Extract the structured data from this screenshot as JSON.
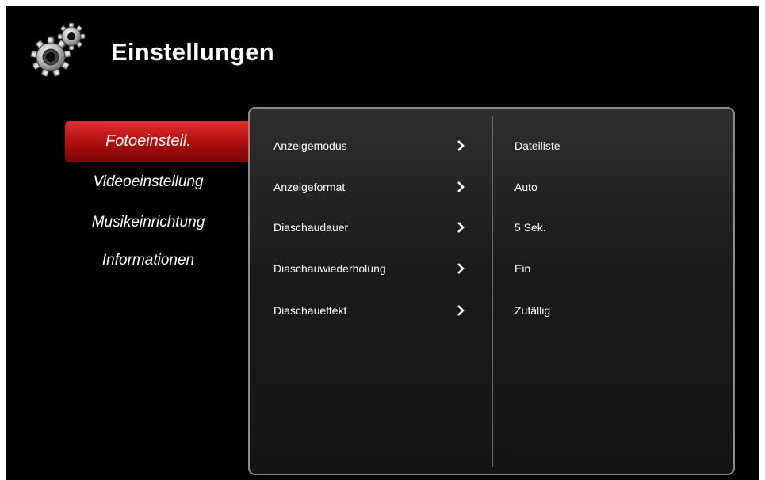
{
  "header": {
    "title": "Einstellungen",
    "icon": "gear-icon"
  },
  "sidebar": {
    "items": [
      {
        "label": "Fotoeinstell.",
        "active": true
      },
      {
        "label": "Videoeinstellung",
        "active": false
      },
      {
        "label": "Musikeinrichtung",
        "active": false
      },
      {
        "label": "Informationen",
        "active": false
      }
    ]
  },
  "settings": {
    "rows": [
      {
        "label": "Anzeigemodus",
        "value": "Dateiliste"
      },
      {
        "label": "Anzeigeformat",
        "value": "Auto"
      },
      {
        "label": "Diaschaudauer",
        "value": "5 Sek."
      },
      {
        "label": "Diaschauwiederholung",
        "value": "Ein"
      },
      {
        "label": "Diaschaueffekt",
        "value": "Zufällig"
      }
    ]
  },
  "colors": {
    "background": "#000000",
    "accent": "#c81414",
    "panel_border": "#8a8a8a",
    "text": "#ffffff"
  }
}
